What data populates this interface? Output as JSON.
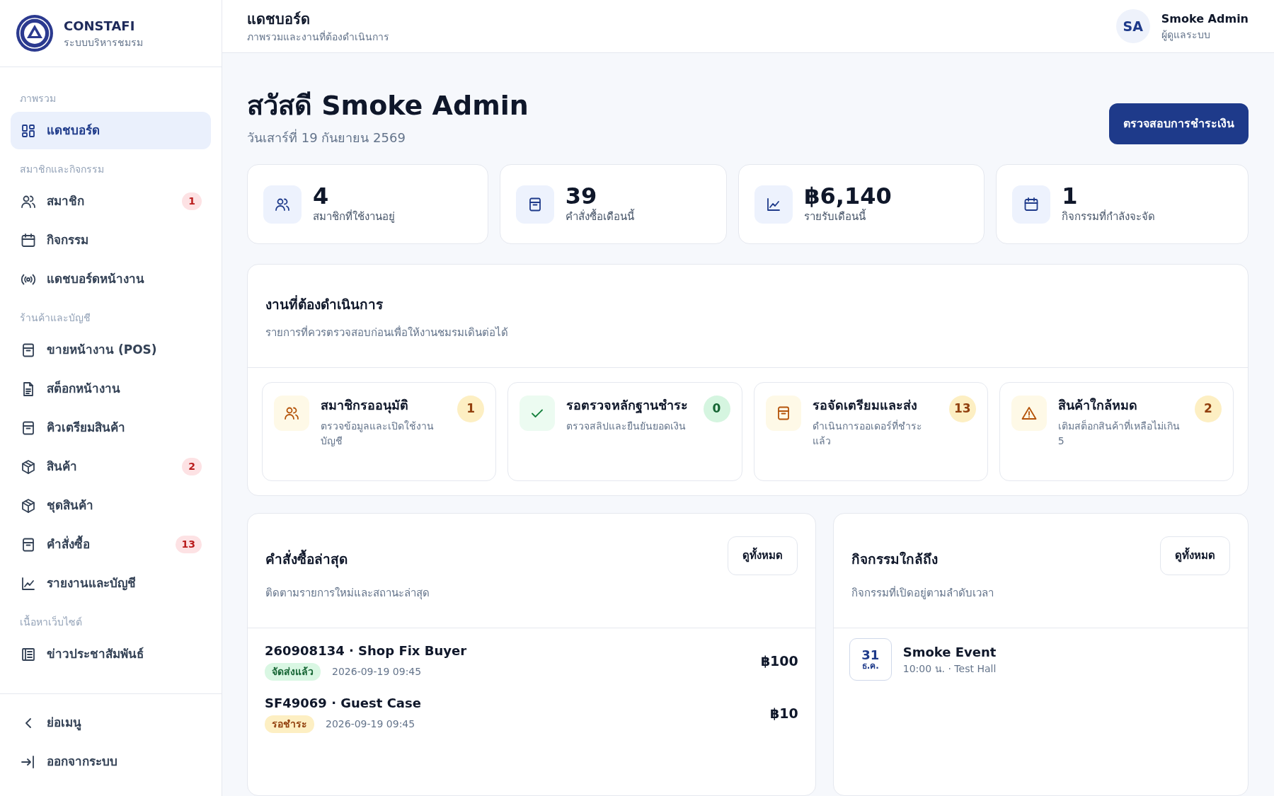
{
  "brand": {
    "name": "CONSTAFI",
    "subtitle": "ระบบบริหารชมรม"
  },
  "sidebar": {
    "sections": [
      {
        "title": "ภาพรวม",
        "items": [
          {
            "label": "แดชบอร์ด",
            "selected": true
          }
        ]
      },
      {
        "title": "สมาชิกและกิจกรรม",
        "items": [
          {
            "label": "สมาชิก",
            "selected": false,
            "badge": "1"
          },
          {
            "label": "กิจกรรม",
            "selected": false
          },
          {
            "label": "แดชบอร์ดหน้างาน",
            "selected": false
          }
        ]
      },
      {
        "title": "ร้านค้าและบัญชี",
        "items": [
          {
            "label": "ขายหน้างาน (POS)",
            "selected": false
          },
          {
            "label": "สต็อกหน้างาน",
            "selected": false
          },
          {
            "label": "คิวเตรียมสินค้า",
            "selected": false
          },
          {
            "label": "สินค้า",
            "selected": false,
            "badge": "2"
          },
          {
            "label": "ชุดสินค้า",
            "selected": false
          },
          {
            "label": "คำสั่งซื้อ",
            "selected": false,
            "badge": "13"
          },
          {
            "label": "รายงานและบัญชี",
            "selected": false
          }
        ]
      },
      {
        "title": "เนื้อหาเว็บไซต์",
        "items": [
          {
            "label": "ข่าวประชาสัมพันธ์",
            "selected": false
          }
        ]
      }
    ],
    "footer": [
      "ย่อเมนู",
      "ออกจากระบบ"
    ]
  },
  "header": {
    "title": "แดชบอร์ด",
    "subtitle": "ภาพรวมและงานที่ต้องดำเนินการ",
    "user": {
      "initials": "SA",
      "name": "Smoke Admin",
      "role": "ผู้ดูแลระบบ"
    }
  },
  "greeting": {
    "title": "สวัสดี Smoke Admin",
    "date": "วันเสาร์ที่ 19 กันยายน 2569",
    "button": "ตรวจสอบการชำระเงิน"
  },
  "stats": [
    {
      "value": "4",
      "label": "สมาชิกที่ใช้งานอยู่"
    },
    {
      "value": "39",
      "label": "คำสั่งซื้อเดือนนี้"
    },
    {
      "value": "฿6,140",
      "label": "รายรับเดือนนี้"
    },
    {
      "value": "1",
      "label": "กิจกรรมที่กำลังจะจัด"
    }
  ],
  "tasks": {
    "title": "งานที่ต้องดำเนินการ",
    "subtitle": "รายการที่ควรตรวจสอบก่อนเพื่อให้งานชมรมเดินต่อได้",
    "items": [
      {
        "kind": "warning",
        "title": "สมาชิกรออนุมัติ",
        "description": "ตรวจข้อมูลและเปิดใช้งานบัญชี",
        "count": "1"
      },
      {
        "kind": "success",
        "title": "รอตรวจหลักฐานชำระ",
        "description": "ตรวจสลิปและยืนยันยอดเงิน",
        "count": "0"
      },
      {
        "kind": "warning",
        "title": "รอจัดเตรียมและส่ง",
        "description": "ดำเนินการออเดอร์ที่ชำระแล้ว",
        "count": "13"
      },
      {
        "kind": "warning",
        "title": "สินค้าใกล้หมด",
        "description": "เติมสต็อกสินค้าที่เหลือไม่เกิน 5",
        "count": "2"
      }
    ]
  },
  "orders": {
    "title": "คำสั่งซื้อล่าสุด",
    "subtitle": "ติดตามรายการใหม่และสถานะล่าสุด",
    "button": "ดูทั้งหมด",
    "items": [
      {
        "title": "260908134 · Shop Fix Buyer",
        "status": "จัดส่งแล้ว",
        "kind": "success",
        "time": "2026-09-19 09:45",
        "amount": "฿100"
      },
      {
        "title": "SF49069 · Guest Case",
        "status": "รอชำระ",
        "kind": "warning",
        "time": "2026-09-19 09:45",
        "amount": "฿10"
      }
    ]
  },
  "events": {
    "title": "กิจกรรมใกล้ถึง",
    "subtitle": "กิจกรรมที่เปิดอยู่ตามลำดับเวลา",
    "button": "ดูทั้งหมด",
    "items": [
      {
        "day": "31",
        "month": "ธ.ค.",
        "title": "Smoke Event",
        "detail": "10:00 น. · Test Hall"
      }
    ]
  }
}
